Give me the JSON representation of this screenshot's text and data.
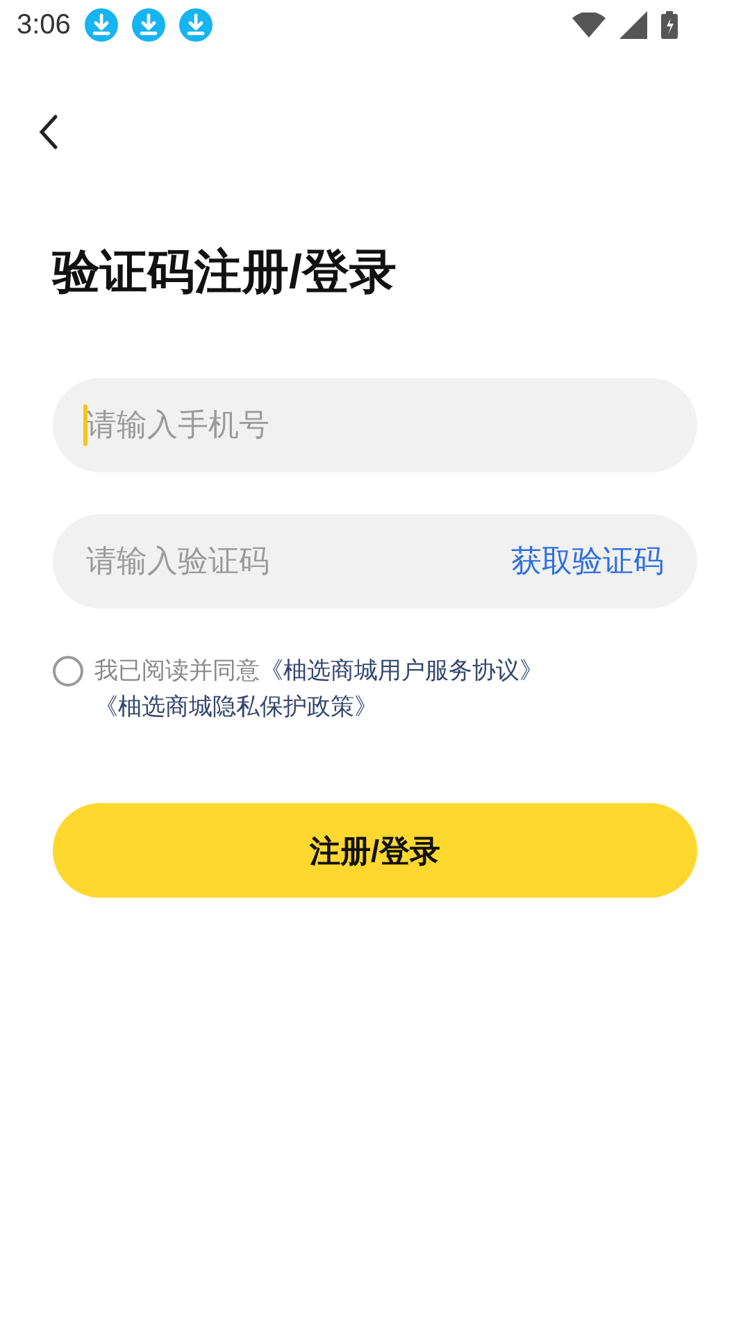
{
  "status_bar": {
    "time": "3:06",
    "notifications": [
      {
        "kind": "download"
      },
      {
        "kind": "download"
      },
      {
        "kind": "download"
      }
    ]
  },
  "title": "验证码注册/登录",
  "phone_field": {
    "placeholder": "请输入手机号",
    "focused": true
  },
  "code_field": {
    "placeholder": "请输入验证码",
    "action": "获取验证码"
  },
  "agreement": {
    "checked": false,
    "text": "我已阅读并同意",
    "links": [
      "《柚选商城用户服务协议》",
      "《柚选商城隐私保护政策》"
    ]
  },
  "submit_button": "注册/登录"
}
